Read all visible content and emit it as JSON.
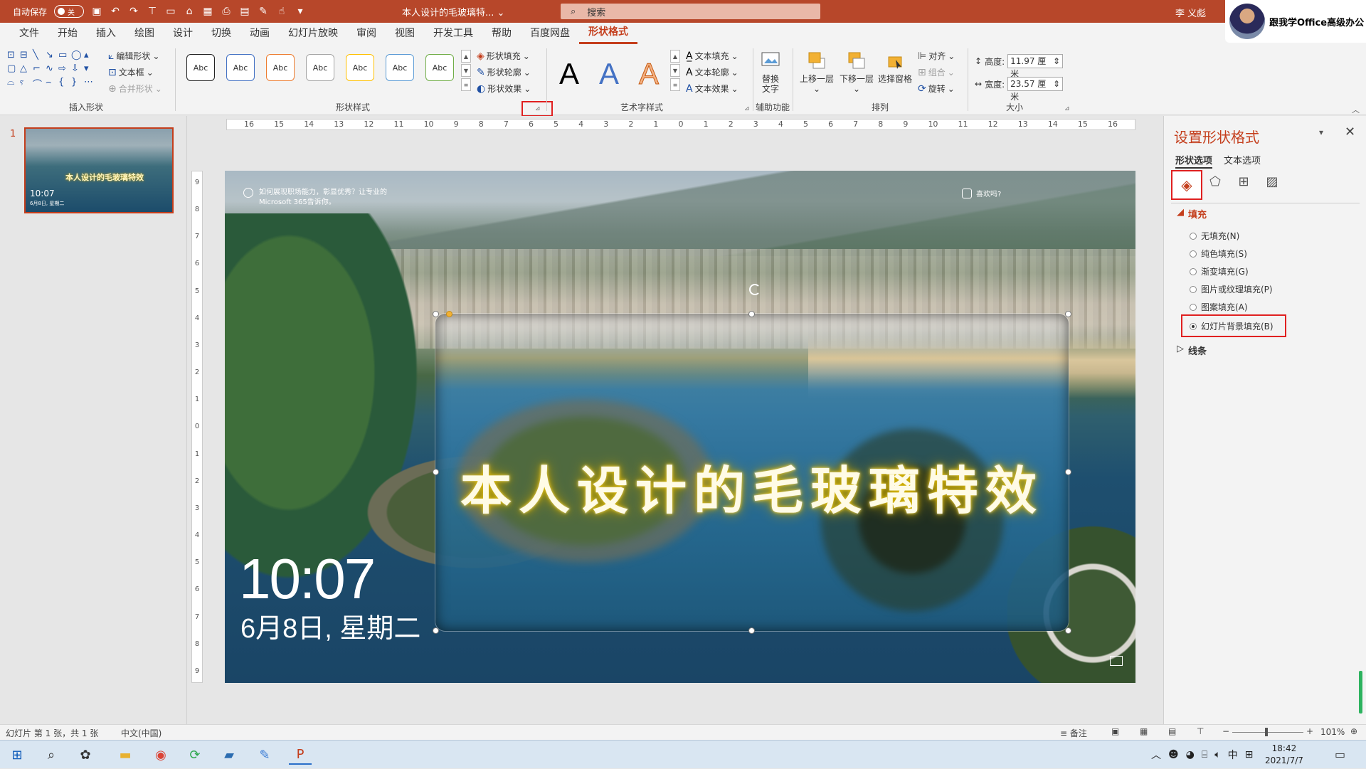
{
  "titlebar": {
    "autosave_label": "自动保存",
    "autosave_state": "关",
    "doc_title": "本人设计的毛玻璃特...",
    "search_placeholder": "搜索",
    "user_name": "李 义彪",
    "promo_text": "跟我学Office高级办公"
  },
  "menu": {
    "tabs": [
      "文件",
      "开始",
      "插入",
      "绘图",
      "设计",
      "切换",
      "动画",
      "幻灯片放映",
      "审阅",
      "视图",
      "开发工具",
      "帮助",
      "百度网盘",
      "形状格式"
    ],
    "active": "形状格式"
  },
  "ribbon": {
    "insert_shapes": {
      "label": "插入形状",
      "edit_shape": "编辑形状",
      "text_box": "文本框",
      "merge_shapes": "合并形状"
    },
    "shape_styles": {
      "label": "形状样式",
      "swatch_text": "Abc",
      "swatch_colors": [
        "#222222",
        "#4472c4",
        "#ed7d31",
        "#a5a5a5",
        "#ffc000",
        "#5b9bd5",
        "#70ad47"
      ],
      "shape_fill": "形状填充",
      "shape_outline": "形状轮廓",
      "shape_effects": "形状效果"
    },
    "wordart": {
      "label": "艺术字样式",
      "letter": "A",
      "text_fill": "文本填充",
      "text_outline": "文本轮廓",
      "text_effects": "文本效果"
    },
    "accessibility": {
      "label": "辅助功能",
      "alt_text_line1": "替换",
      "alt_text_line2": "文字"
    },
    "arrange": {
      "label": "排列",
      "bring_forward": "上移一层",
      "send_backward": "下移一层",
      "selection_pane": "选择窗格",
      "align": "对齐",
      "group": "组合",
      "rotate": "旋转"
    },
    "size": {
      "label": "大小",
      "height_label": "高度:",
      "height_value": "11.97 厘米",
      "width_label": "宽度:",
      "width_value": "23.57 厘米"
    }
  },
  "ruler_h_ticks": [
    "16",
    "15",
    "14",
    "13",
    "12",
    "11",
    "10",
    "9",
    "8",
    "7",
    "6",
    "5",
    "4",
    "3",
    "2",
    "1",
    "0",
    "1",
    "2",
    "3",
    "4",
    "5",
    "6",
    "7",
    "8",
    "9",
    "10",
    "11",
    "12",
    "13",
    "14",
    "15",
    "16"
  ],
  "ruler_v_ticks": [
    "9",
    "8",
    "7",
    "6",
    "5",
    "4",
    "3",
    "2",
    "1",
    "0",
    "1",
    "2",
    "3",
    "4",
    "5",
    "6",
    "7",
    "8",
    "9"
  ],
  "thumbnail": {
    "number": "1",
    "title": "本人设计的毛玻璃特效",
    "time": "10:07",
    "date": "6月8日, 星期二"
  },
  "slide": {
    "lock_msg_line1": "如何展现职场能力，彰显优秀？让专业的",
    "lock_msg_line2": "Microsoft 365告诉你。",
    "like_msg": "喜欢吗?",
    "clock": "10:07",
    "date": "6月8日, 星期二",
    "glass_title": "本人设计的毛玻璃特效"
  },
  "format_pane": {
    "title": "设置形状格式",
    "tab_shape": "形状选项",
    "tab_text": "文本选项",
    "fill_header": "填充",
    "options": [
      "无填充(N)",
      "纯色填充(S)",
      "渐变填充(G)",
      "图片或纹理填充(P)",
      "图案填充(A)",
      "幻灯片背景填充(B)"
    ],
    "selected": "幻灯片背景填充(B)",
    "line_header": "线条"
  },
  "statusbar": {
    "slide_info": "幻灯片 第 1 张，共 1 张",
    "language": "中文(中国)",
    "notes": "备注",
    "zoom": "101%"
  },
  "taskbar": {
    "time": "18:42",
    "date": "2021/7/7",
    "ime": "中"
  }
}
